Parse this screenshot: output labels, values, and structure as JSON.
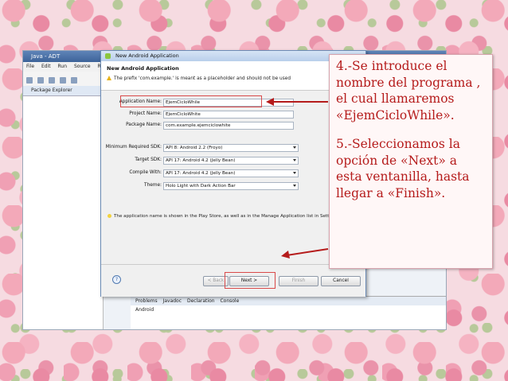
{
  "eclipse": {
    "title": "Java - ADT",
    "menu": [
      "File",
      "Edit",
      "Run",
      "Source",
      "Refac"
    ],
    "package_explorer": "Package Explorer",
    "console_tabs": [
      "Problems",
      "Javadoc",
      "Declaration",
      "Console"
    ],
    "console_text": "Android"
  },
  "dialog": {
    "title": "New Android Application",
    "heading": "New Android Application",
    "warning": "The prefix 'com.example.' is meant as a placeholder and should not be used",
    "fields": {
      "app_name_label": "Application Name:",
      "app_name_value": "EjemCicloWhile",
      "project_name_label": "Project Name:",
      "project_name_value": "EjemCicloWhite",
      "package_name_label": "Package Name:",
      "package_name_value": "com.example.ejemciclowhite"
    },
    "selects": {
      "min_sdk_label": "Minimum Required SDK:",
      "min_sdk_value": "API 8: Android 2.2 (Froyo)",
      "target_sdk_label": "Target SDK:",
      "target_sdk_value": "API 17: Android 4.2 (Jelly Bean)",
      "compile_with_label": "Compile With:",
      "compile_with_value": "API 17: Android 4.2 (Jelly Bean)",
      "theme_label": "Theme:",
      "theme_value": "Holo Light with Dark Action Bar"
    },
    "info": "The application name is shown in the Play Store, as well as in the Manage Application list in Setti",
    "buttons": {
      "back": "< Back",
      "next": "Next >",
      "finish": "Finish",
      "cancel": "Cancel"
    }
  },
  "note": {
    "step4": "4.-Se introduce el nombre del programa , el cual llamaremos «EjemCicloWhile».",
    "step5": "5.-Seleccionamos la opción de «Next» a esta ventanilla, hasta llegar a «Finish»."
  },
  "colors": {
    "note_text": "#b51b1b",
    "highlight": "#d94a4a"
  }
}
